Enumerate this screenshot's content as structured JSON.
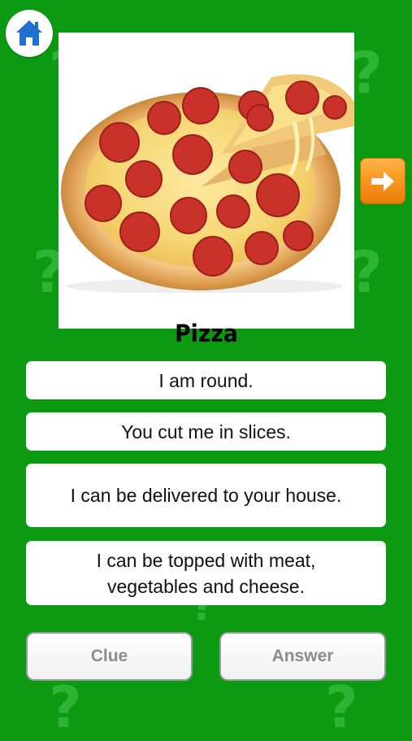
{
  "card": {
    "image_icon": "pizza-photo",
    "title": "Pizza"
  },
  "clues": [
    "I am round.",
    "You cut me in slices.",
    "I can be delivered to your house.",
    "I can be topped with meat, vegetables and cheese."
  ],
  "buttons": {
    "clue_label": "Clue",
    "answer_label": "Answer"
  },
  "icons": {
    "home": "home-icon",
    "next": "arrow-right-icon"
  },
  "colors": {
    "background": "#0c9a12",
    "next_button": "#f7931e",
    "home_icon": "#1e6fd0"
  }
}
